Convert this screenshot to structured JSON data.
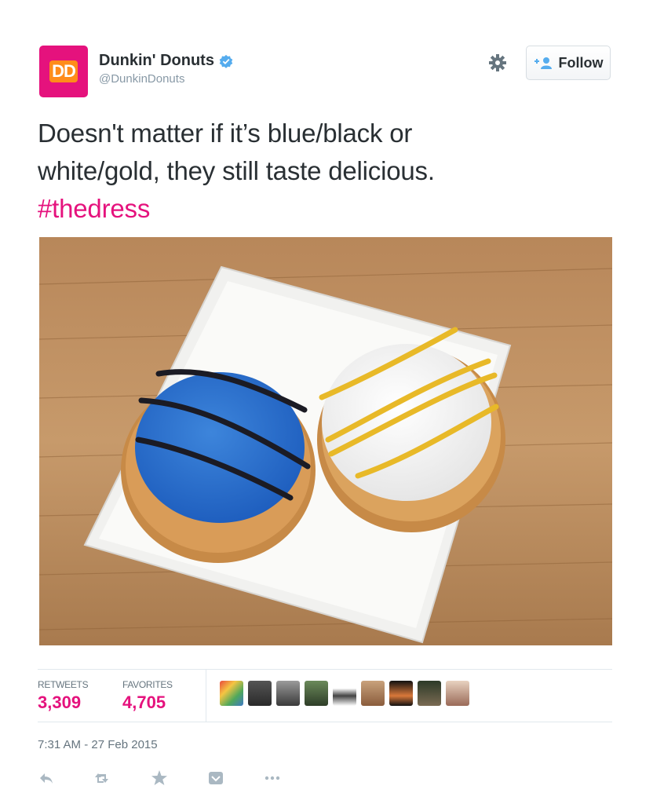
{
  "user": {
    "avatar_text": "DD",
    "name": "Dunkin' Donuts",
    "screen_name": "@DunkinDonuts"
  },
  "follow_button": {
    "label": "Follow"
  },
  "tweet": {
    "text_line1": "Doesn't matter if it’s blue/black or",
    "text_line2": "white/gold, they still taste delicious.",
    "hashtag": "#thedress"
  },
  "stats": {
    "retweets_label": "RETWEETS",
    "retweets_count": "3,309",
    "favorites_label": "FAVORITES",
    "favorites_count": "4,705"
  },
  "timestamp": "7:31 AM - 27 Feb 2015",
  "colors": {
    "accent": "#e5127d",
    "verified": "#55acee",
    "muted": "#8899a6"
  },
  "icons": [
    "verified-badge-icon",
    "gear-icon",
    "follow-person-icon",
    "reply-icon",
    "retweet-icon",
    "favorite-star-icon",
    "pocket-icon",
    "more-dots-icon"
  ]
}
